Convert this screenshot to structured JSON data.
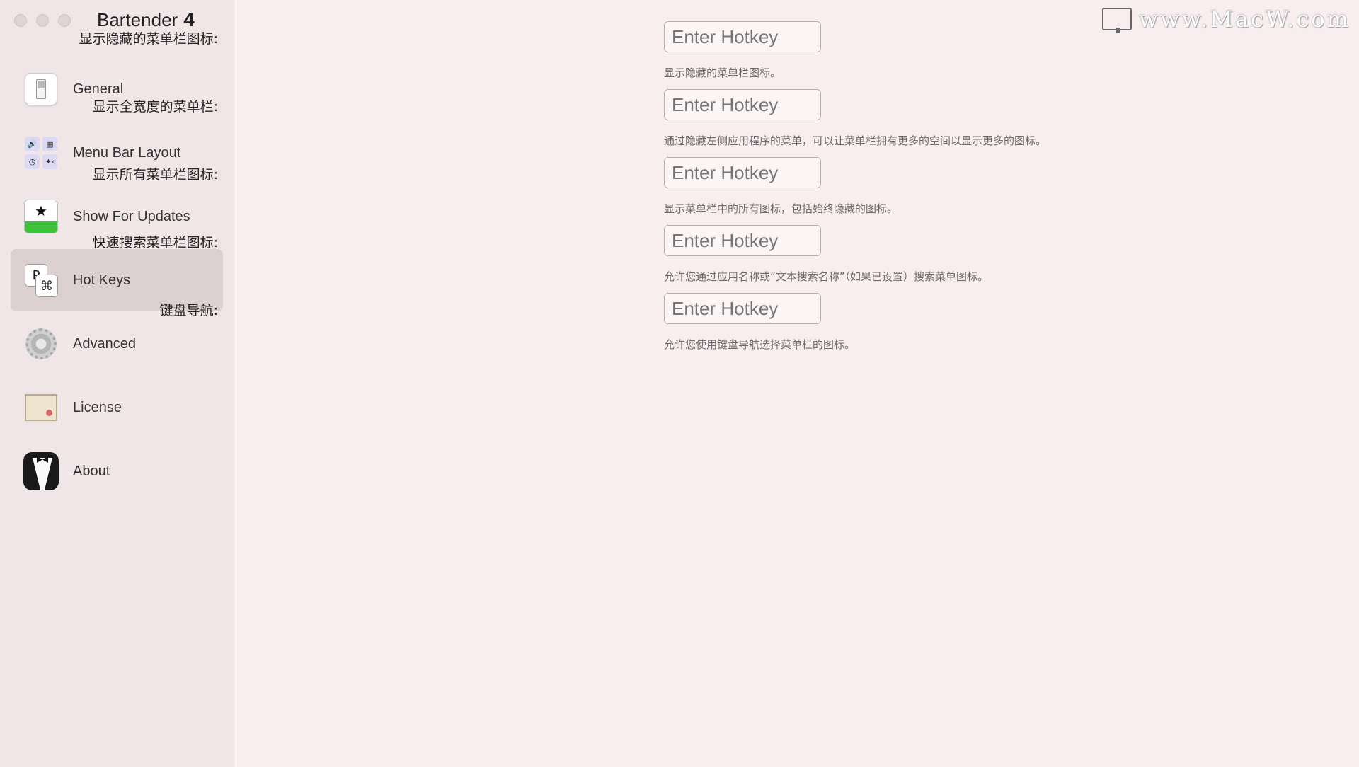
{
  "app": {
    "name": "Bartender",
    "version": "4"
  },
  "sidebar": {
    "items": [
      {
        "label": "General",
        "icon": "toggle-switch-icon"
      },
      {
        "label": "Menu Bar Layout",
        "icon": "menu-bar-layout-icon"
      },
      {
        "label": "Show For Updates",
        "icon": "star-icon"
      },
      {
        "label": "Hot Keys",
        "icon": "hotkeys-icon",
        "selected": true
      },
      {
        "label": "Advanced",
        "icon": "gear-icon"
      },
      {
        "label": "License",
        "icon": "certificate-icon"
      },
      {
        "label": "About",
        "icon": "bartender-tuxedo-icon"
      }
    ]
  },
  "hotkeys": [
    {
      "label": "显示隐藏的菜单栏图标:",
      "placeholder": "Enter Hotkey",
      "desc": "显示隐藏的菜单栏图标。"
    },
    {
      "label": "显示全宽度的菜单栏:",
      "placeholder": "Enter Hotkey",
      "desc": "通过隐藏左侧应用程序的菜单，可以让菜单栏拥有更多的空间以显示更多的图标。"
    },
    {
      "label": "显示所有菜单栏图标:",
      "placeholder": "Enter Hotkey",
      "desc": "显示菜单栏中的所有图标，包括始终隐藏的图标。"
    },
    {
      "label": "快速搜索菜单栏图标:",
      "placeholder": "Enter Hotkey",
      "desc": "允许您通过应用名称或“文本搜索名称”（如果已设置）搜索菜单图标。"
    },
    {
      "label": "键盘导航:",
      "placeholder": "Enter Hotkey",
      "desc": "允许您使用键盘导航选择菜单栏的图标。"
    }
  ],
  "watermark": {
    "text": "www.MacW.com"
  },
  "colors": {
    "sidebar_bg": "#f1e6e7",
    "main_bg": "#f8eeef",
    "selected_bg": "#dcd0d1"
  }
}
